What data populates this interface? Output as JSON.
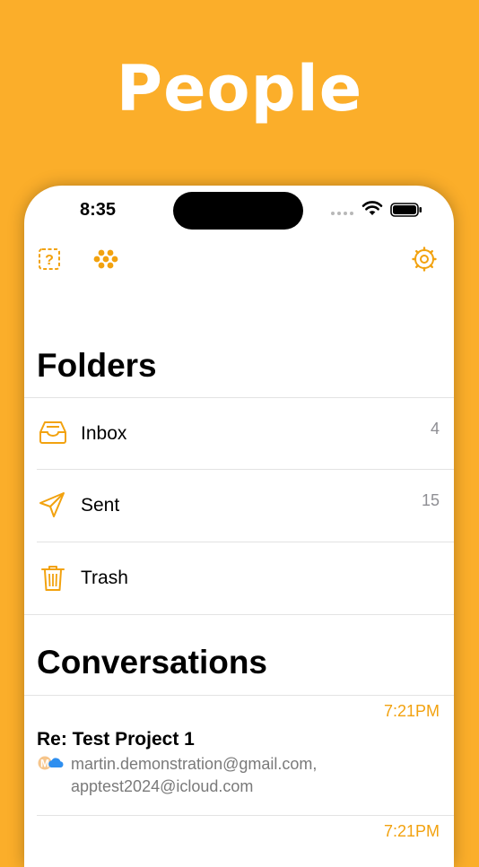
{
  "headline": "People",
  "status_bar": {
    "time": "8:35"
  },
  "folders": {
    "title": "Folders",
    "items": [
      {
        "label": "Inbox",
        "count": "4",
        "icon": "inbox-tray-icon"
      },
      {
        "label": "Sent",
        "count": "15",
        "icon": "paper-plane-icon"
      },
      {
        "label": "Trash",
        "count": "",
        "icon": "trash-can-icon"
      }
    ]
  },
  "conversations": {
    "title": "Conversations",
    "items": [
      {
        "time": "7:21PM",
        "subject": "Re: Test Project 1",
        "participants_line1": "martin.demonstration@gmail.com,",
        "participants_line2": "apptest2024@icloud.com"
      },
      {
        "time": "7:21PM"
      }
    ]
  },
  "colors": {
    "accent": "#F2A20F",
    "background": "#FBAE2A"
  }
}
